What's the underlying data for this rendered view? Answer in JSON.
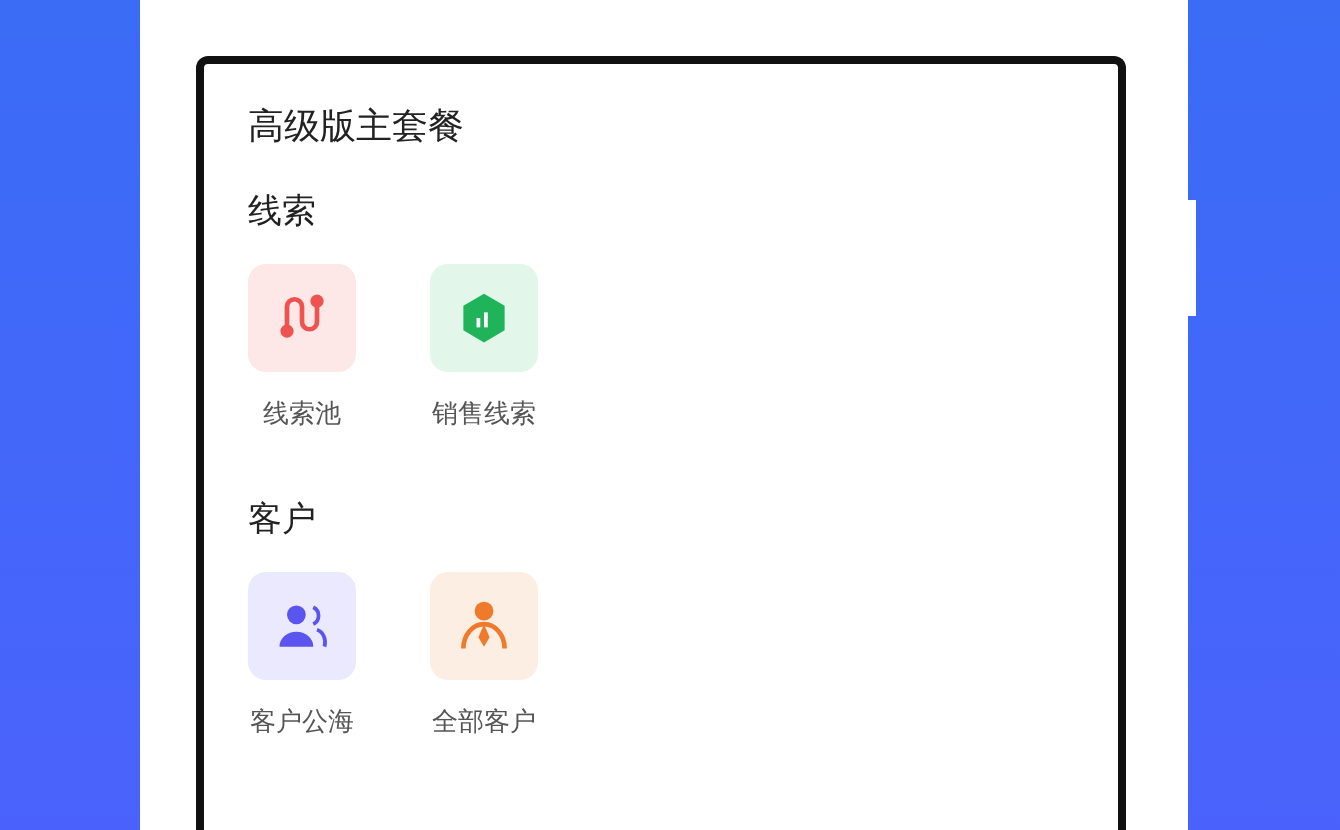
{
  "title": "高级版主套餐",
  "sections": [
    {
      "title": "线索",
      "items": [
        {
          "label": "线索池",
          "kind": "route",
          "color": "#ef5350"
        },
        {
          "label": "销售线索",
          "kind": "hexagon",
          "color": "#1fb45a"
        }
      ]
    },
    {
      "title": "客户",
      "items": [
        {
          "label": "客户公海",
          "kind": "people",
          "color": "#5b55f0"
        },
        {
          "label": "全部客户",
          "kind": "person",
          "color": "#f07a2c"
        }
      ]
    }
  ]
}
